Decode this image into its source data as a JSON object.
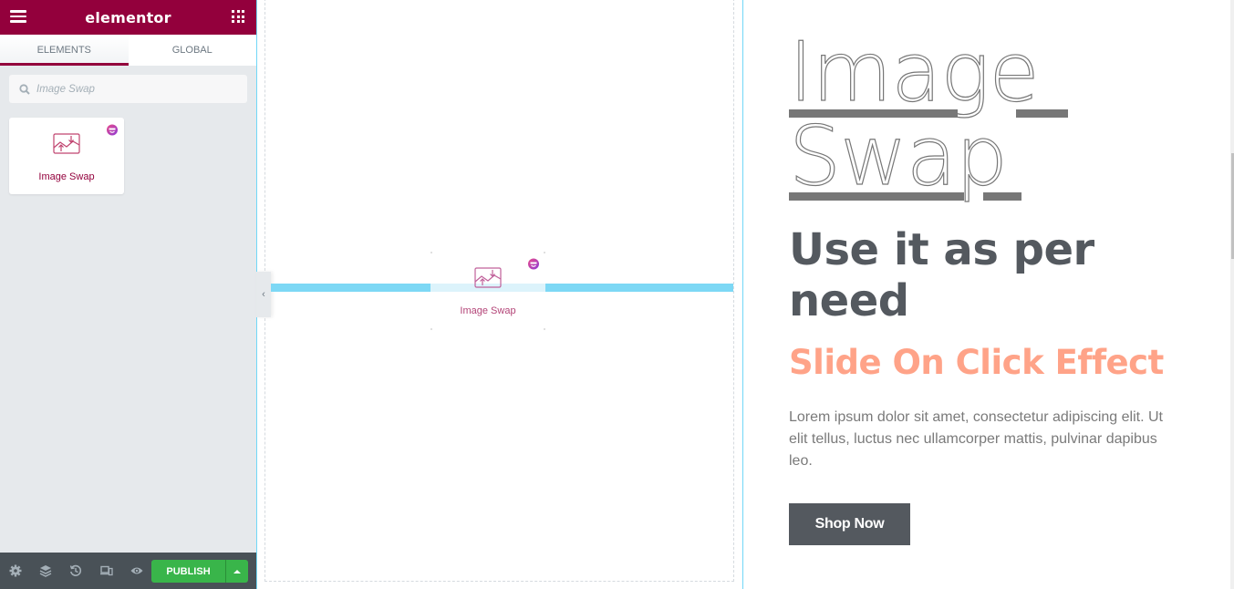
{
  "panel": {
    "logo": "elementor",
    "tabs": [
      {
        "label": "ELEMENTS",
        "active": true
      },
      {
        "label": "GLOBAL",
        "active": false
      }
    ],
    "search": {
      "value": "",
      "placeholder": "Image Swap"
    },
    "elements": [
      {
        "label": "Image Swap",
        "icon": "image-swap-icon",
        "badge": "pro-addon-badge-icon"
      }
    ],
    "footer": {
      "icons": [
        "settings-icon",
        "navigator-layers-icon",
        "history-icon",
        "responsive-mode-icon",
        "preview-eye-icon"
      ],
      "publish_label": "PUBLISH"
    }
  },
  "canvas": {
    "dragging_widget": {
      "label": "Image Swap"
    },
    "toggle_panel_glyph": "‹"
  },
  "content": {
    "title_lines": [
      "Image",
      "Swap"
    ],
    "subtitle": "Use it as per need",
    "effect": "Slide On Click Effect",
    "body": "Lorem ipsum dolor sit amet, consectetur adipiscing elit. Ut elit tellus, luctus nec ullamcorper mattis, pulvinar dapibus leo.",
    "button_label": "Shop Now"
  },
  "colors": {
    "brand": "#93003c",
    "publish": "#39b54a",
    "drop_indicator": "#7dd8f5",
    "effect_text": "#ffa388",
    "heading": "#54595f"
  }
}
